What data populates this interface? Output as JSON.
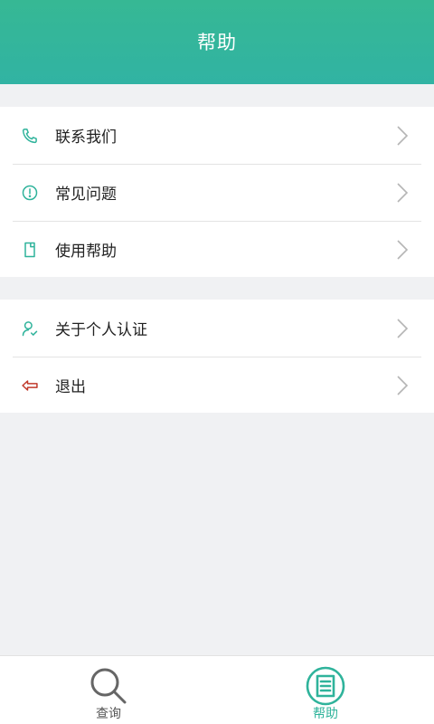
{
  "header": {
    "title": "帮助"
  },
  "menu": {
    "group1": [
      {
        "label": "联系我们",
        "icon": "phone-icon"
      },
      {
        "label": "常见问题",
        "icon": "exclamation-circle-icon"
      },
      {
        "label": "使用帮助",
        "icon": "document-icon"
      }
    ],
    "group2": [
      {
        "label": "关于个人认证",
        "icon": "user-check-icon"
      },
      {
        "label": "退出",
        "icon": "logout-arrow-icon"
      }
    ]
  },
  "tabbar": {
    "tabs": [
      {
        "label": "查询",
        "icon": "search-icon",
        "active": false
      },
      {
        "label": "帮助",
        "icon": "list-document-icon",
        "active": true
      }
    ]
  },
  "colors": {
    "accent": "#2fb39b",
    "header_gradient_top": "#36b894",
    "header_gradient_bottom": "#31b3a3",
    "logout_icon": "#c0392b"
  }
}
